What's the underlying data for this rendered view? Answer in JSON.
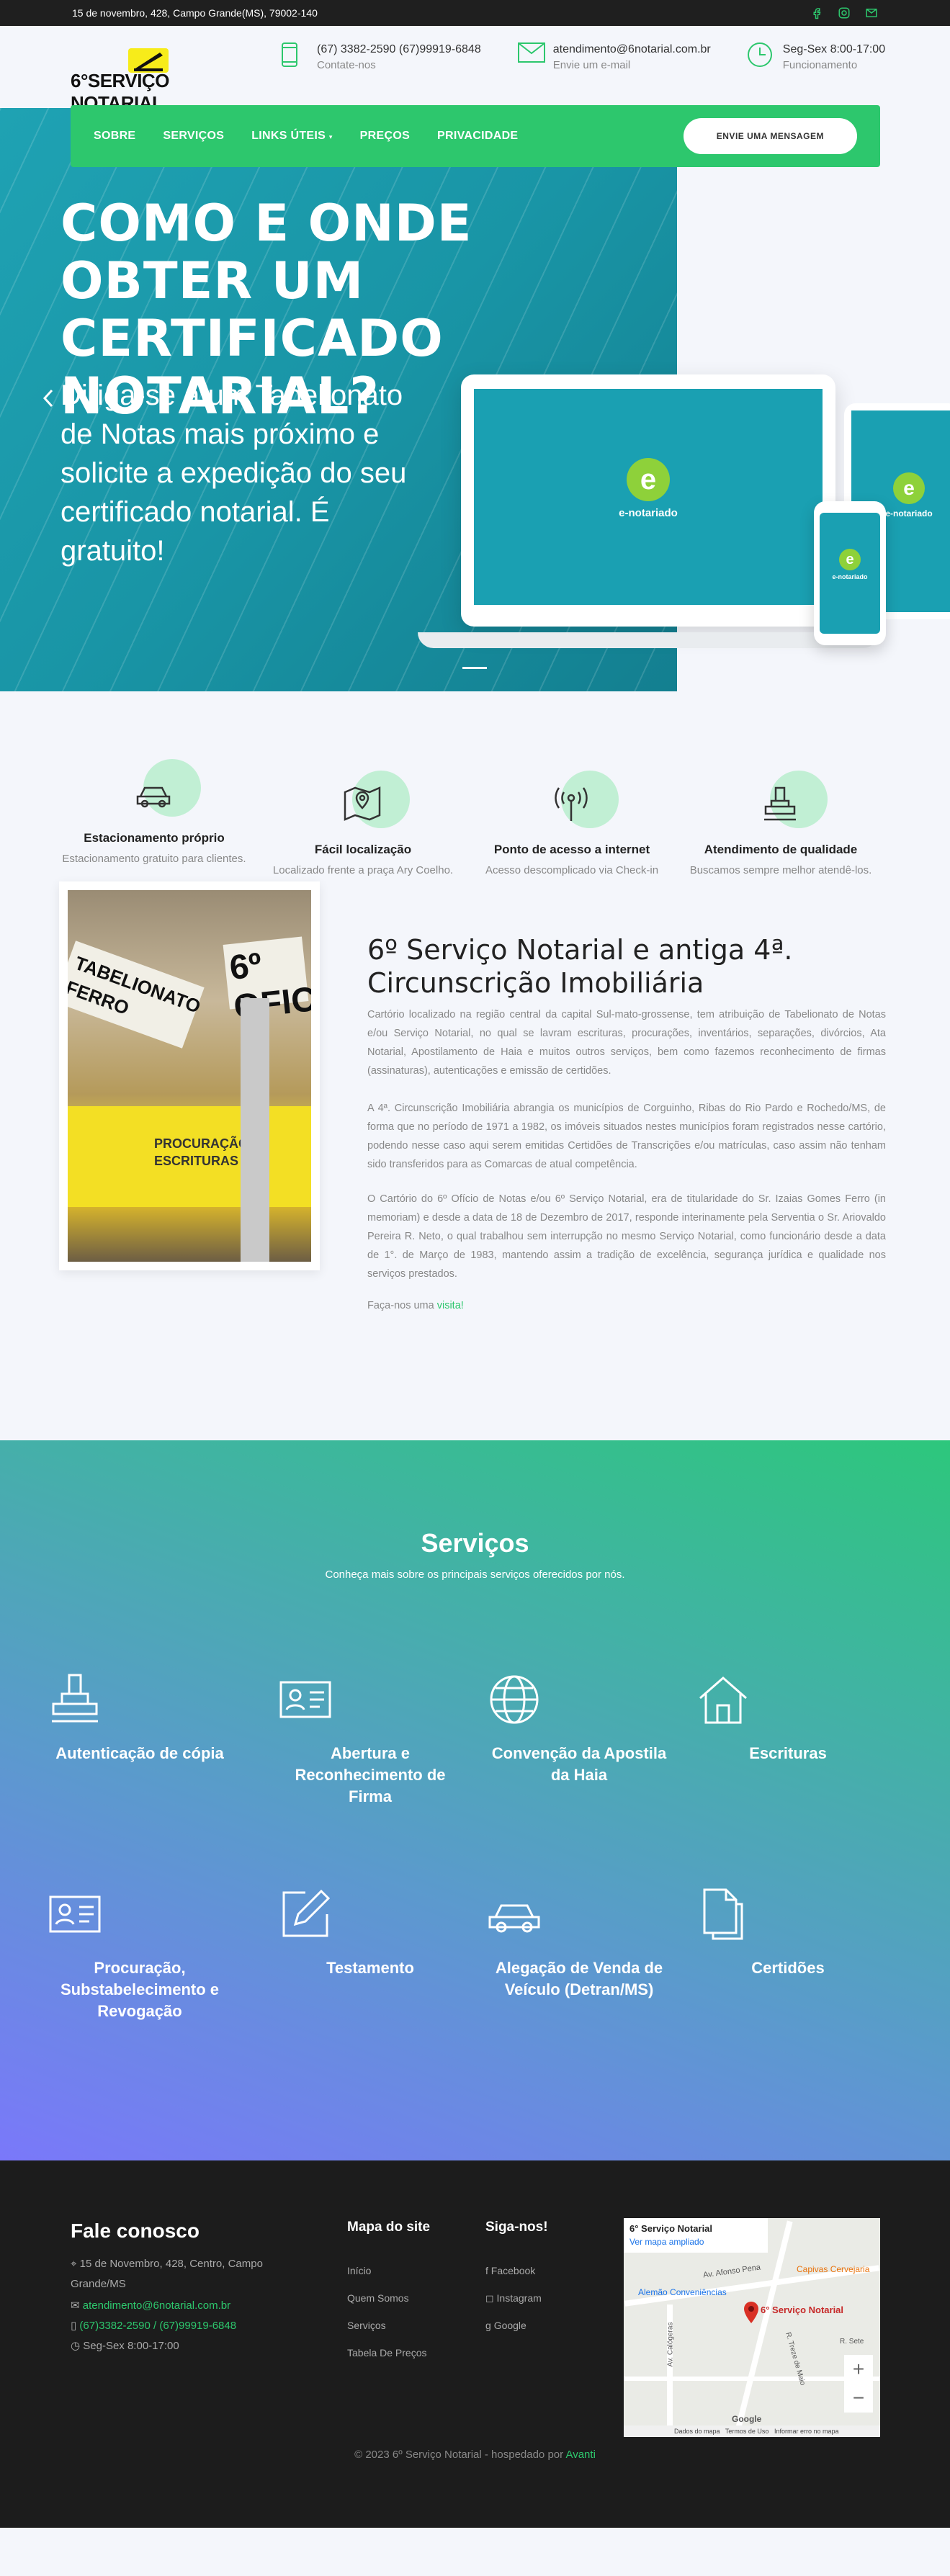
{
  "topbar": {
    "address": "15 de novembro, 428, Campo Grande(MS), 79002-140",
    "socials": [
      "facebook-icon",
      "instagram-icon",
      "mail-icon"
    ]
  },
  "brand": {
    "logo_text": "6°SERVIÇO NOTARIAL",
    "accent": "#2dc76d",
    "logo_yellow": "#f7ec1a"
  },
  "header": {
    "contacts": [
      {
        "icon": "phone-icon",
        "line1": "(67) 3382-2590 (67)99919-6848",
        "line2": "Contate-nos"
      },
      {
        "icon": "mail-icon",
        "line1": "atendimento@6notarial.com.br",
        "line2": "Envie um e-mail"
      },
      {
        "icon": "clock-icon",
        "line1": "Seg-Sex 8:00-17:00",
        "line2": "Funcionamento"
      }
    ]
  },
  "nav": {
    "items": [
      "SOBRE",
      "SERVIÇOS",
      "LINKS ÚTEIS",
      "PREÇOS",
      "PRIVACIDADE"
    ],
    "cta": "ENVIE UMA MENSAGEM"
  },
  "hero": {
    "title": "COMO E ONDE OBTER UM CERTIFICADO NOTARIAL?",
    "subtitle": "Diriga-se a um Tabelionato de Notas mais próximo e solicite a expedição do seu certificado notarial. É gratuito!",
    "brand_label": "e-notariado"
  },
  "features": [
    {
      "icon": "car-icon",
      "title": "Estacionamento próprio",
      "desc": "Estacionamento gratuito para clientes."
    },
    {
      "icon": "map-icon",
      "title": "Fácil localização",
      "desc": "Localizado frente a praça Ary Coelho."
    },
    {
      "icon": "wifi-icon",
      "title": "Ponto de acesso a internet",
      "desc": "Acesso descomplicado via Check-in"
    },
    {
      "icon": "stamp-icon",
      "title": "Atendimento de qualidade",
      "desc": "Buscamos sempre melhor atendê-los."
    }
  ],
  "about": {
    "title": "6º Serviço Notarial e antiga 4ª. Circunscrição Imobiliária",
    "p1": "Cartório localizado na região central da capital Sul-mato-grossense, tem atribuição de Tabelionato de Notas e/ou Serviço Notarial, no qual se lavram escrituras, procurações, inventários, separações, divórcios, Ata Notarial, Apostilamento de Haia e muitos outros serviços, bem como fazemos reconhecimento de firmas (assinaturas), autenticações e emissão de certidões.",
    "p2": "A 4ª. Circunscrição Imobiliária abrangia os municípios de Corguinho, Ribas do Rio Pardo e Rochedo/MS, de forma que no período de 1971 a 1982, os imóveis situados nestes municípios foram registrados nesse cartório, podendo nesse caso aqui serem emitidas Certidões de Transcrições e/ou matrículas, caso assim não tenham sido transferidos para as Comarcas de atual competência.",
    "p3": "O Cartório do 6º Ofício de Notas e/ou 6º Serviço Notarial, era de titularidade do Sr. Izaias Gomes Ferro (in memoriam) e desde a data de 18 de Dezembro de 2017, responde interinamente pela Serventia o Sr. Ariovaldo Pereira R. Neto, o qual trabalhou sem interrupção no mesmo Serviço Notarial, como funcionário desde a data de 1°. de Março de 1983, mantendo assim a tradição de excelência, segurança jurídica e qualidade nos serviços prestados.",
    "visit_prefix": "Faça-nos uma",
    "visit_link": "visita!",
    "photo": {
      "sign_left": "TABELIONATO FERRO",
      "sign_right": "6º OFICI",
      "yellow_sign": "PROCURAÇÃO ESCRITURAS"
    }
  },
  "services": {
    "title": "Serviços",
    "subtitle": "Conheça mais sobre os principais serviços oferecidos por nós.",
    "items": [
      {
        "icon": "stamp-icon",
        "label": "Autenticação de cópia"
      },
      {
        "icon": "id-card-icon",
        "label": "Abertura e Reconhecimento de Firma"
      },
      {
        "icon": "globe-icon",
        "label": "Convenção da Apostila da Haia"
      },
      {
        "icon": "house-icon",
        "label": "Escrituras"
      },
      {
        "icon": "id-card-icon",
        "label": "Procuração, Substabelecimento e Revogação"
      },
      {
        "icon": "edit-icon",
        "label": "Testamento"
      },
      {
        "icon": "car-icon",
        "label": "Alegação de Venda de Veículo (Detran/MS)"
      },
      {
        "icon": "documents-icon",
        "label": "Certidões"
      }
    ]
  },
  "footer": {
    "contact_title": "Fale conosco",
    "address": "15 de Novembro, 428, Centro, Campo Grande/MS",
    "email": "atendimento@6notarial.com.br",
    "phone": "(67)3382-2590 / (67)99919-6848",
    "hours": "Seg-Sex 8:00-17:00",
    "sitemap_title": "Mapa do site",
    "sitemap": [
      "Início",
      "Quem Somos",
      "Serviços",
      "Tabela De Preços"
    ],
    "follow_title": "Siga-nos!",
    "follow": [
      "Facebook",
      "Instagram",
      "Google"
    ],
    "map": {
      "place": "6° Serviço Notarial",
      "link": "Ver mapa ampliado",
      "streets": [
        "Av. Afonso Pena",
        "R. Treze de Maio",
        "Av. Calógeras",
        "R. Sete"
      ],
      "pois": [
        "Alemão Conveniências",
        "Capivas Cervejaria"
      ],
      "zoom_in": "+",
      "zoom_out": "−",
      "attribution": [
        "Dados do mapa",
        "Termos de Uso",
        "Informar erro no mapa"
      ],
      "logo": "Google"
    },
    "copyright_prefix": "© 2023 6º Serviço Notarial - hospedado por",
    "copyright_link": "Avanti"
  }
}
